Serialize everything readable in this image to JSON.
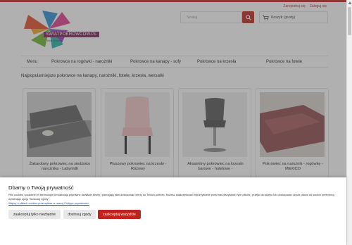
{
  "header": {
    "register_label": "Zarejestruj się",
    "login_label": "Zaloguj się",
    "logo_text": "SWIATPOKROWCOW.PL",
    "logo_tagline": "Your Covers",
    "search_placeholder": "Szukaj",
    "cart_label": "Koszyk: (pusty)"
  },
  "nav": {
    "items": [
      {
        "label": "Menu"
      },
      {
        "label": "Pokrowce na rogówki - narożniki"
      },
      {
        "label": "Pokrowce na kanapy - sofy"
      },
      {
        "label": "Pokrowce na krzesła"
      },
      {
        "label": "Pokrowce na fotele"
      }
    ]
  },
  "main": {
    "section_title": "Najpopularniejsze pokrowce na kanapy, narożniki, fotele, krzesła, wersalki",
    "products": [
      {
        "title": "Żakardowy pokrowiec na siedzisko narożnika - Labyrinth"
      },
      {
        "title": "Pluszowy pokrowiec na krzesło - Różowy"
      },
      {
        "title": "Aksamitny pokrowiec na krzesło barowe - hotelowe -"
      },
      {
        "title": "Pokrowiec na narożnik - rogówkę - MEXICO"
      }
    ]
  },
  "consent": {
    "title": "Dbamy o Twoją prywatność",
    "body": "Pliki cookies i podobne im technologie umożliwiają poprawne działanie strony i pomagają nam dostosować oferty do Twoich potrzeb. Możesz zaakceptować wykorzystanie przez nas wszystkich tych plików i przejść do sklepu lub dostosować użycie plików do swoich preferencji, wybierając opcję \"Dostosuj zgody\".",
    "link": "Więcej o plikach cookies przeczytasz w naszej Polityce prywatności.",
    "buttons": {
      "necessary": "zaakceptuj tylko niezbędne",
      "customize": "dostosuj zgody",
      "accept_all": "zaakceptuj wszystkie"
    }
  },
  "colors": {
    "accent": "#c0241c",
    "link": "#1a4fa0",
    "overlay": "rgba(80,80,80,0.45)"
  }
}
